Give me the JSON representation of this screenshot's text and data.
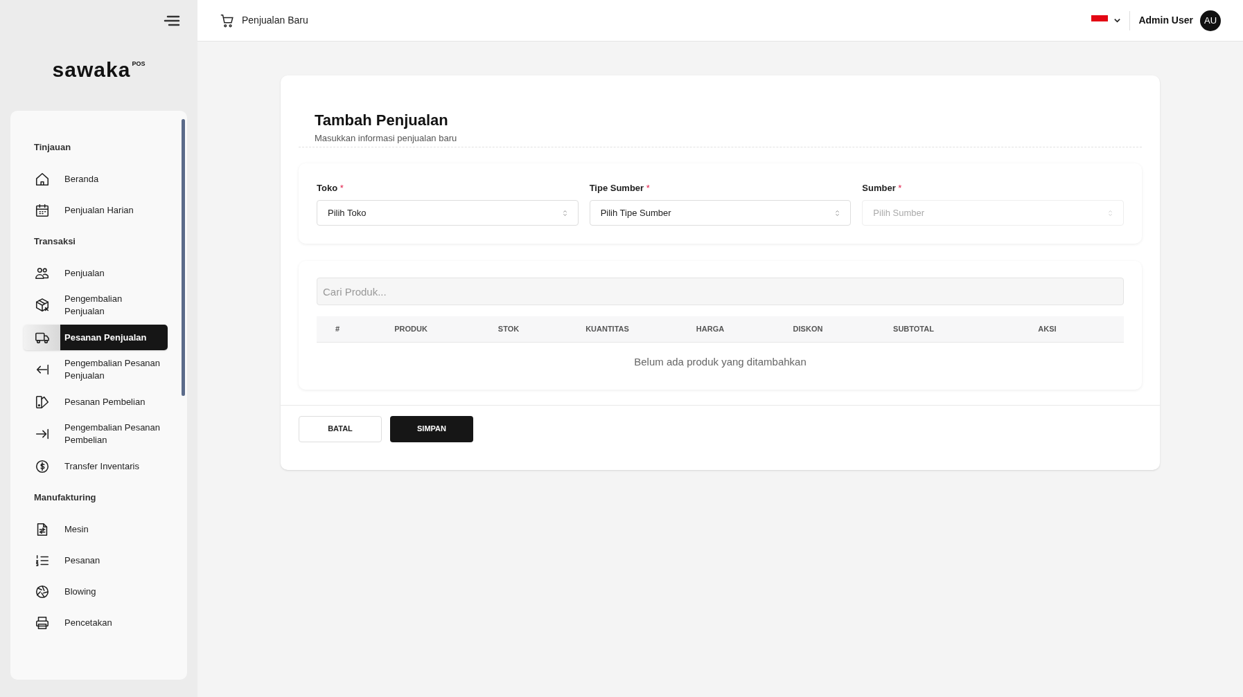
{
  "header": {
    "page_title": "Penjualan Baru",
    "user_name": "Admin User",
    "avatar_initials": "AU"
  },
  "brand": {
    "name": "sawaka",
    "superscript": "POS"
  },
  "sidebar": {
    "items": [
      {
        "kind": "section",
        "label": "Tinjauan"
      },
      {
        "kind": "item",
        "label": "Beranda",
        "selected": false
      },
      {
        "kind": "item",
        "label": "Penjualan Harian",
        "selected": false
      },
      {
        "kind": "section",
        "label": "Transaksi"
      },
      {
        "kind": "item",
        "label": "Penjualan",
        "selected": false
      },
      {
        "kind": "item",
        "label": "Pengembalian Penjualan",
        "selected": false
      },
      {
        "kind": "item",
        "label": "Pesanan Penjualan",
        "selected": true
      },
      {
        "kind": "item",
        "label": "Pengembalian Pesanan Penjualan",
        "selected": false
      },
      {
        "kind": "item",
        "label": "Pesanan Pembelian",
        "selected": false
      },
      {
        "kind": "item",
        "label": "Pengembalian Pesanan Pembelian",
        "selected": false
      },
      {
        "kind": "item",
        "label": "Transfer Inventaris",
        "selected": false
      },
      {
        "kind": "section",
        "label": "Manufakturing"
      },
      {
        "kind": "item",
        "label": "Mesin",
        "selected": false
      },
      {
        "kind": "item",
        "label": "Pesanan",
        "selected": false
      },
      {
        "kind": "item",
        "label": "Blowing",
        "selected": false
      },
      {
        "kind": "item",
        "label": "Pencetakan",
        "selected": false
      }
    ]
  },
  "form": {
    "title": "Tambah Penjualan",
    "subtitle": "Masukkan informasi penjualan baru",
    "fields": [
      {
        "label": "Toko",
        "required_mark": "*",
        "placeholder": "Pilih Toko",
        "disabled": false
      },
      {
        "label": "Tipe Sumber",
        "required_mark": "*",
        "placeholder": "Pilih Tipe Sumber",
        "disabled": false
      },
      {
        "label": "Sumber",
        "required_mark": "*",
        "placeholder": "Pilih Sumber",
        "disabled": true
      }
    ],
    "product_search": {
      "placeholder": "Cari Produk..."
    },
    "table": {
      "columns": [
        "#",
        "PRODUK",
        "STOK",
        "KUANTITAS",
        "HARGA",
        "DISKON",
        "SUBTOTAL",
        "AKSI"
      ],
      "empty_message": "Belum ada produk yang ditambahkan"
    },
    "buttons": [
      {
        "kind": "secondary",
        "label": "BATAL"
      },
      {
        "kind": "primary",
        "label": "SIMPAN"
      }
    ]
  }
}
